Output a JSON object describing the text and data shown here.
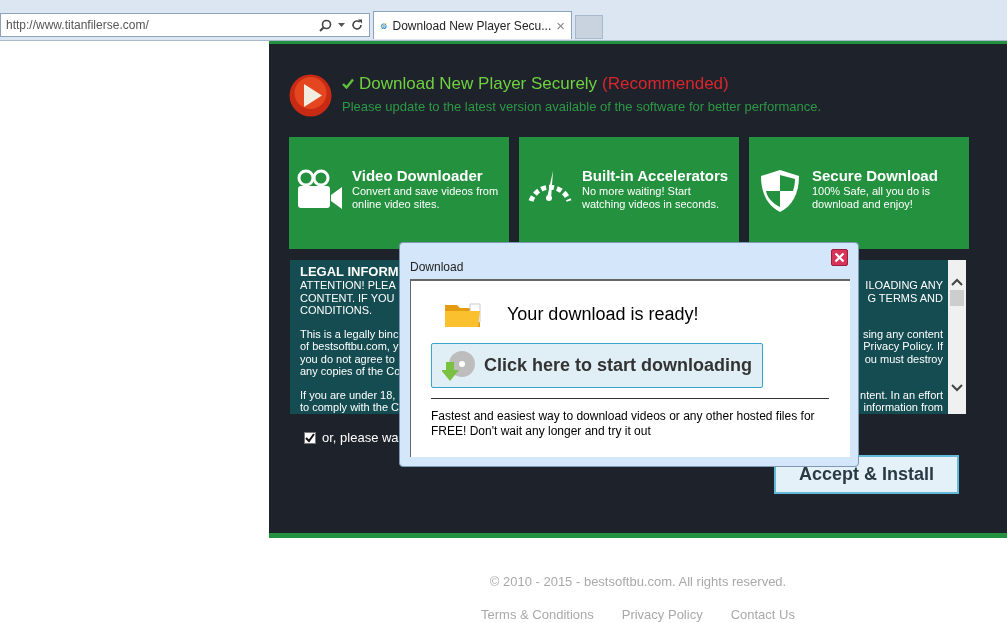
{
  "browser": {
    "address": "http://www.titanfilerse.com/",
    "tab": {
      "title": "Download New Player Secu...",
      "close": "×",
      "selected": true
    }
  },
  "header": {
    "title": "Download New Player Securely",
    "badge": "(Recommended)",
    "subtitle": "Please update to the latest version available of the software for better performance."
  },
  "features": [
    {
      "kind": "camera",
      "title": "Video Downloader",
      "text": "Convert and save videos from online video sites."
    },
    {
      "kind": "gauge",
      "title": "Built-in Accelerators",
      "text": "No more waiting! Start watching videos in seconds."
    },
    {
      "kind": "shield",
      "title": "Secure Download",
      "text": "100% Safe, all you do is download and enjoy!"
    }
  ],
  "legal": {
    "title": "LEGAL INFORM",
    "paragraphs": [
      [
        {
          "left": "ATTENTION! PLEA",
          "right": "ILOADING ANY"
        },
        {
          "left": "CONTENT. IF YOU",
          "right": "G TERMS AND"
        },
        {
          "left": "CONDITIONS."
        }
      ],
      [
        {
          "left": "This is a legally binc",
          "right": "sing any content"
        },
        {
          "left": "of bestsoftbu.com, y",
          "right": "Privacy Policy. If"
        },
        {
          "left": "you do not agree to",
          "right": "ou must destroy"
        },
        {
          "left": "any copies of the Co"
        }
      ],
      [
        {
          "left": "If you are under 18,",
          "right": "ntent. In an effort"
        },
        {
          "left": "to comply with the C",
          "right": "information from"
        }
      ]
    ]
  },
  "agree": {
    "checked": true,
    "label": "or, please wa"
  },
  "accept_button": "Accept & Install",
  "dialog": {
    "title": "Download",
    "heading": "Your download is ready!",
    "button": "Click here to start downloading",
    "text": "Fastest and easiest way to download videos or any other hosted files for FREE! Don't wait any longer and try it out"
  },
  "footer": {
    "copyright": "© 2010 - 2015 - bestsoftbu.com. All rights reserved.",
    "links": [
      "Terms & Conditions",
      "Privacy Policy",
      "Contact Us"
    ]
  }
}
